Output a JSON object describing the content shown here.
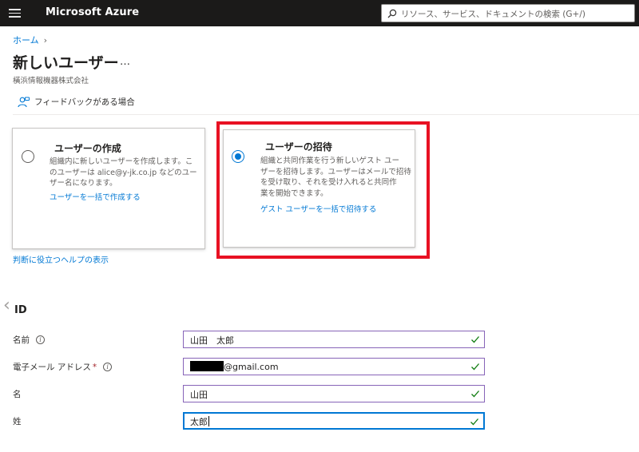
{
  "topbar": {
    "app_title": "Microsoft Azure",
    "search_placeholder": "リソース、サービス、ドキュメントの検索 (G+/)"
  },
  "breadcrumb": {
    "home": "ホーム"
  },
  "page": {
    "title": "新しいユーザー",
    "more": "…",
    "subtitle": "橫浜情報機器株式会社"
  },
  "feedback": {
    "label": "フィードバックがある場合"
  },
  "options": {
    "create": {
      "title": "ユーザーの作成",
      "desc_line1": "組織内に新しいユーザーを作成します。こ",
      "desc_line2": "のユーザーは alice@y-jk.co.jp などのユー",
      "desc_line3": "ザー名になります。",
      "link": "ユーザーを一括で作成する",
      "selected": false
    },
    "invite": {
      "title": "ユーザーの招待",
      "desc_line1": "組織と共同作業を行う新しいゲスト ユー",
      "desc_line2": "ザーを招待します。ユーザーはメールで招待",
      "desc_line3": "を受け取り、それを受け入れると共同作",
      "desc_line4": "業を開始できます。",
      "link": "ゲスト ユーザーを一括で招待する",
      "selected": true
    }
  },
  "help_link": "判断に役立つヘルプの表示",
  "identity": {
    "section_title": "ID",
    "fields": {
      "name": {
        "label": "名前",
        "value": "山田　太郎"
      },
      "email": {
        "label": "電子メール アドレス",
        "required": "*",
        "value_suffix": "@gmail.com"
      },
      "first_name": {
        "label": "名",
        "value": "山田"
      },
      "last_name": {
        "label": "姓",
        "value": "太郎"
      }
    }
  },
  "colors": {
    "accent": "#0078d4",
    "highlight": "#e81123",
    "valid_check": "#107c10",
    "input_border": "#8764b8"
  }
}
